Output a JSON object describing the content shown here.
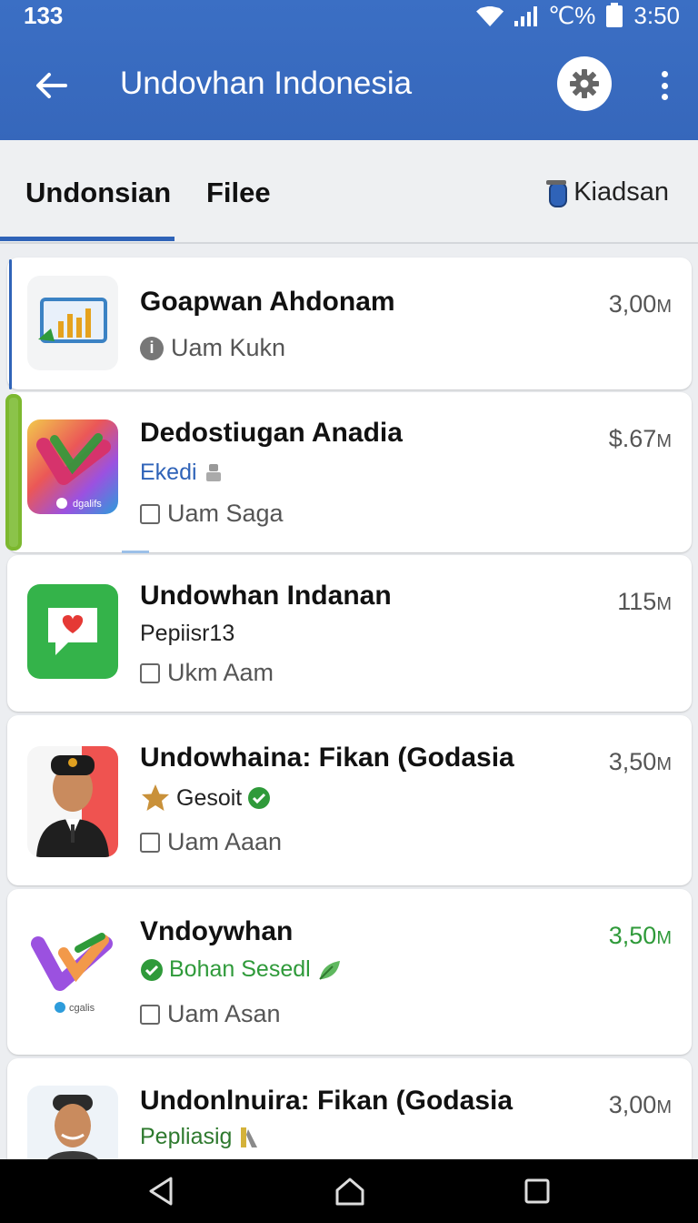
{
  "status_bar": {
    "left_text": "133",
    "right_symbols": "℃%",
    "time": "3:50"
  },
  "header": {
    "title": "Undovhan Indonesia"
  },
  "tabs": [
    {
      "label": "Undonsian"
    },
    {
      "label": "Filee"
    }
  ],
  "tab_action": {
    "label": "Kiadsan"
  },
  "items": [
    {
      "name": "Goapwan Ahdonam",
      "size": "3,00",
      "size_unit": "M",
      "meta": "Uam Kukn"
    },
    {
      "name": "Dedostiugan Anadia",
      "size": "$.67",
      "size_unit": "M",
      "subtitle": "Ekedi",
      "meta": "Uam Saga",
      "thumb_caption": "dgalifs"
    },
    {
      "name": "Undowhan Indanan",
      "size": "115",
      "size_unit": "M",
      "subtitle": "Pepiisr13",
      "meta": "Ukm Aam"
    },
    {
      "name": "Undowhaina: Fikan (Godasia",
      "size": "3,50",
      "size_unit": "M",
      "subtitle": "Gesoit",
      "meta": "Uam Aaan"
    },
    {
      "name": "Vndoywhan",
      "size": "3,50",
      "size_unit": "M",
      "subtitle": "Bohan Sesedl",
      "meta": "Uam Asan",
      "thumb_caption": "cgalis"
    },
    {
      "name": "Undonlnuira: Fikan (Godasia",
      "size": "3,00",
      "size_unit": "M",
      "subtitle": "Pepliasig"
    }
  ],
  "colors": {
    "app_bar": "#3667bb",
    "accent": "#2f63b8",
    "green": "#2f9a3a",
    "link_blue": "#2f63b8"
  }
}
